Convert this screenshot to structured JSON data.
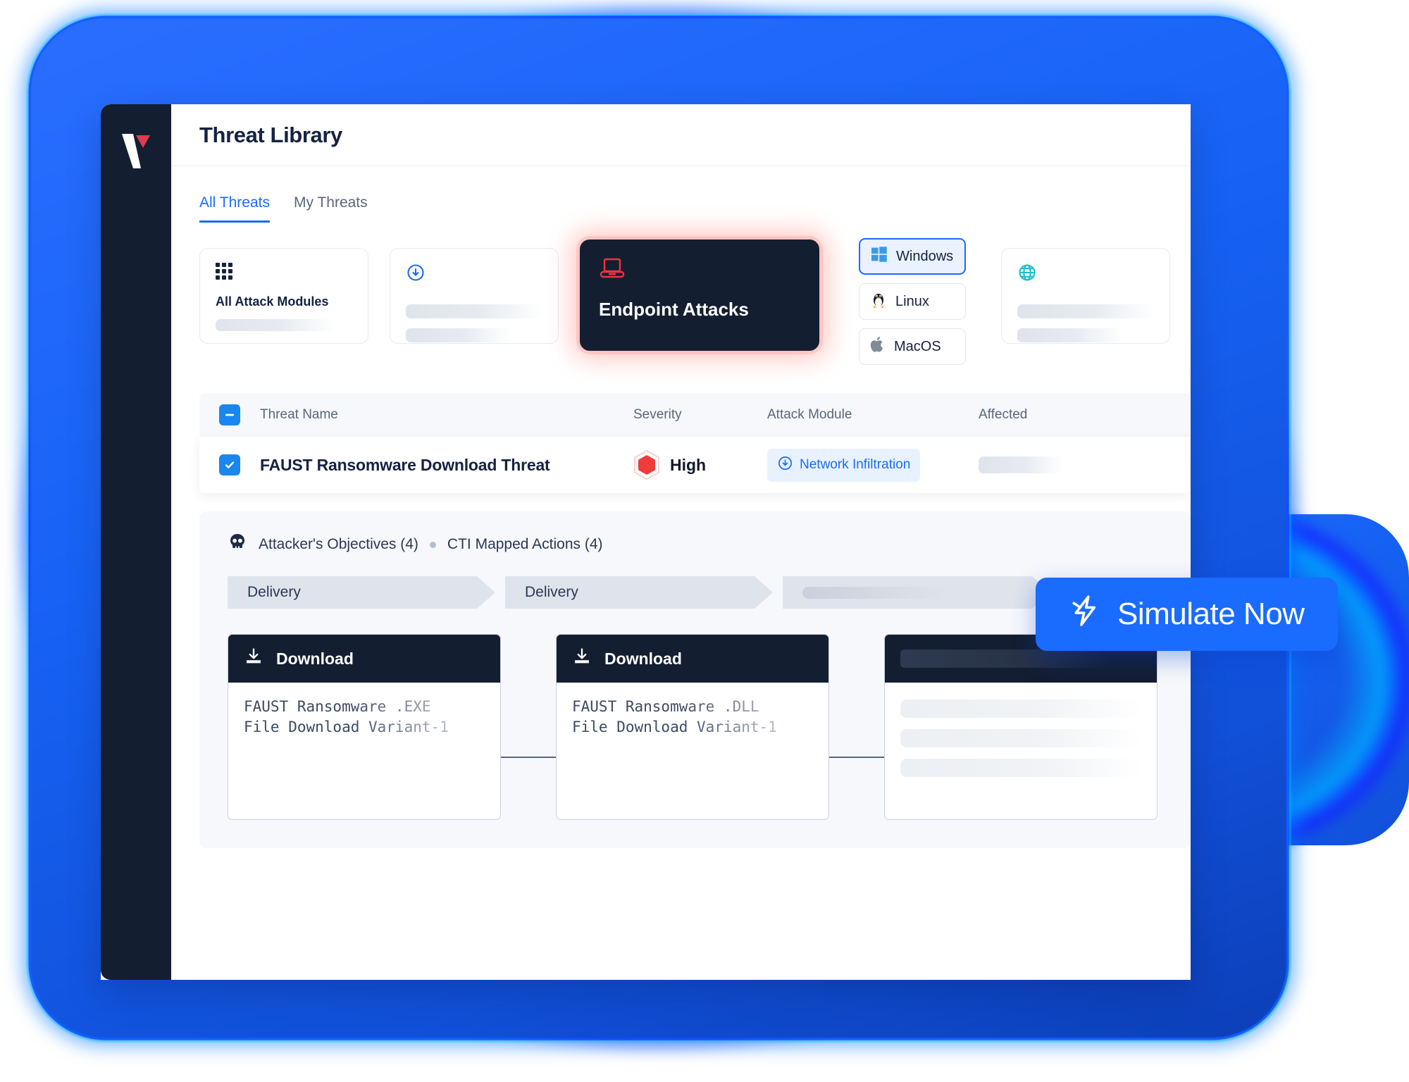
{
  "app": {
    "logo_icon": "picus-v-logo-icon",
    "page_title": "Threat Library"
  },
  "tabs": [
    {
      "label": "All Threats",
      "active": true
    },
    {
      "label": "My Threats",
      "active": false
    }
  ],
  "filter_cards": [
    {
      "title": "All Attack Modules",
      "icon": "grid-icon",
      "state": "default"
    },
    {
      "title": "",
      "icon": "download-circle-icon",
      "state": "skeleton"
    },
    {
      "title": "Endpoint Attacks",
      "icon": "laptop-icon",
      "state": "selected"
    },
    {
      "title": "",
      "icon": "globe-icon",
      "state": "skeleton"
    }
  ],
  "os_filter": [
    {
      "label": "Windows",
      "icon": "windows-icon",
      "selected": true
    },
    {
      "label": "Linux",
      "icon": "linux-penguin-icon",
      "selected": false
    },
    {
      "label": "MacOS",
      "icon": "apple-icon",
      "selected": false
    }
  ],
  "table": {
    "select_all_icon": "indeterminate-checkbox-icon",
    "columns": [
      "Threat Name",
      "Severity",
      "Attack Module",
      "Affected"
    ],
    "rows": [
      {
        "selected": true,
        "checkbox_icon": "checked-checkbox-icon",
        "name": "FAUST Ransomware Download Threat",
        "severity": "High",
        "severity_icon": "red-hexagon-icon",
        "attack_module": "Network Infiltration",
        "attack_module_icon": "download-circle-icon",
        "affected": ""
      }
    ]
  },
  "detail": {
    "skull_icon": "skull-icon",
    "objectives_label": "Attacker's Objectives (4)",
    "cti_label": "CTI Mapped Actions (4)",
    "phase_chips": [
      "Delivery",
      "Delivery",
      ""
    ],
    "action_cards": [
      {
        "header": "Download",
        "header_icon": "download-tray-icon",
        "line1": "FAUST Ransomware .EXE",
        "line2": "File Download Variant-1",
        "state": "filled"
      },
      {
        "header": "Download",
        "header_icon": "download-tray-icon",
        "line1": "FAUST Ransomware .DLL",
        "line2": "File Download Variant-1",
        "state": "filled"
      },
      {
        "header": "",
        "header_icon": "",
        "line1": "",
        "line2": "",
        "state": "skeleton"
      }
    ]
  },
  "cta": {
    "label": "Simulate Now",
    "icon": "lightning-bolt-icon"
  },
  "colors": {
    "accent_blue": "#1a6bff",
    "dark_navy": "#141e31",
    "severity_red": "#ef3b3b",
    "globe_cyan": "#17c0cf",
    "panel_grey": "#f6f8fb"
  }
}
